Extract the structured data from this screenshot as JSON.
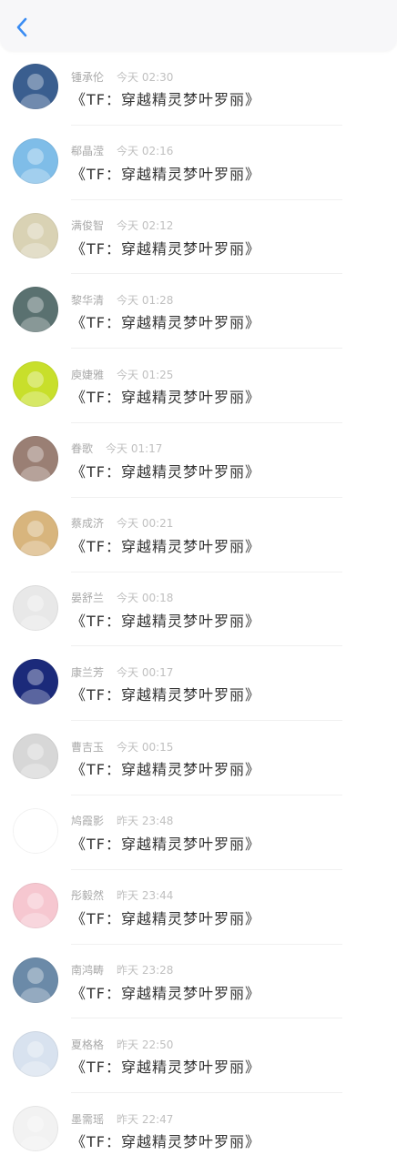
{
  "header": {
    "back_icon": "chevron-left-icon",
    "accent_color": "#3a8cf3"
  },
  "messages": [
    {
      "name": "锺承伦",
      "time": "今天 02:30",
      "text": "《TF：穿越精灵梦叶罗丽》",
      "avatar_color": "#3a5e8f"
    },
    {
      "name": "郗晶滢",
      "time": "今天 02:16",
      "text": "《TF：穿越精灵梦叶罗丽》",
      "avatar_color": "#7fbde8"
    },
    {
      "name": "满俊智",
      "time": "今天 02:12",
      "text": "《TF：穿越精灵梦叶罗丽》",
      "avatar_color": "#d9d2b4"
    },
    {
      "name": "黎华清",
      "time": "今天 01:28",
      "text": "《TF：穿越精灵梦叶罗丽》",
      "avatar_color": "#5a7170"
    },
    {
      "name": "庾婕雅",
      "time": "今天 01:25",
      "text": "《TF：穿越精灵梦叶罗丽》",
      "avatar_color": "#c8df2b"
    },
    {
      "name": "眷歌",
      "time": "今天 01:17",
      "text": "《TF：穿越精灵梦叶罗丽》",
      "avatar_color": "#9a7f74"
    },
    {
      "name": "蔡成济",
      "time": "今天 00:21",
      "text": "《TF：穿越精灵梦叶罗丽》",
      "avatar_color": "#d8b57d"
    },
    {
      "name": "晏舒兰",
      "time": "今天 00:18",
      "text": "《TF：穿越精灵梦叶罗丽》",
      "avatar_color": "#e8e8e8"
    },
    {
      "name": "康兰芳",
      "time": "今天 00:17",
      "text": "《TF：穿越精灵梦叶罗丽》",
      "avatar_color": "#1b2a7a"
    },
    {
      "name": "曹吉玉",
      "time": "今天 00:15",
      "text": "《TF：穿越精灵梦叶罗丽》",
      "avatar_color": "#d7d7d7"
    },
    {
      "name": "鸠霞影",
      "time": "昨天 23:48",
      "text": "《TF：穿越精灵梦叶罗丽》",
      "avatar_color": "#ffffff"
    },
    {
      "name": "彤毅然",
      "time": "昨天 23:44",
      "text": "《TF：穿越精灵梦叶罗丽》",
      "avatar_color": "#f6c7d0"
    },
    {
      "name": "南鸿畴",
      "time": "昨天 23:28",
      "text": "《TF：穿越精灵梦叶罗丽》",
      "avatar_color": "#6b8aa8"
    },
    {
      "name": "夏格格",
      "time": "昨天 22:50",
      "text": "《TF：穿越精灵梦叶罗丽》",
      "avatar_color": "#d8e2ef"
    },
    {
      "name": "墨需瑶",
      "time": "昨天 22:47",
      "text": "《TF：穿越精灵梦叶罗丽》",
      "avatar_color": "#f2f2f2"
    }
  ]
}
